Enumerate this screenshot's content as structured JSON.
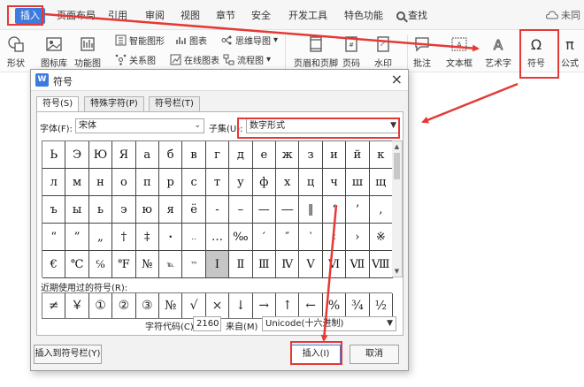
{
  "tabs": {
    "insert": "插入",
    "page_layout": "页面布局",
    "reference": "引用",
    "review": "审阅",
    "view": "视图",
    "chapter": "章节",
    "security": "安全",
    "dev_tools": "开发工具",
    "special": "特色功能",
    "search": "查找",
    "cloud": "未同"
  },
  "ribbon": {
    "shape": "形状",
    "gallery": "图标库",
    "func_chart": "功能图",
    "smart_art": "智能图形",
    "chart": "图表",
    "mind_map": "思维导图",
    "relation_map": "关系图",
    "online_chart": "在线图表",
    "flow_chart": "流程图",
    "header_footer": "页眉和页脚",
    "page_number": "页码",
    "watermark": "水印",
    "comment": "批注",
    "textbox": "文本框",
    "art_text": "艺术字",
    "symbol": "符号",
    "formula": "公式"
  },
  "dialog": {
    "title": "符号",
    "logo": "W",
    "close": "×",
    "tabs": [
      "符号(S)",
      "特殊字符(P)",
      "符号栏(T)"
    ],
    "font_label": "字体(F):",
    "font_value": "宋体",
    "subset_label": "子集(U):",
    "subset_value": "数字形式",
    "recent_label": "近期使用过的符号(R):",
    "code_label": "字符代码(C):",
    "code_value": "2160",
    "from_label": "来自(M)",
    "from_value": "Unicode(十六进制)",
    "insert_to_bar": "插入到符号栏(Y)",
    "insert": "插入(I)",
    "cancel": "取消"
  },
  "grid": {
    "rows": [
      [
        "Ь",
        "Э",
        "Ю",
        "Я",
        "а",
        "б",
        "в",
        "г",
        "д",
        "е",
        "ж",
        "з",
        "и",
        "й",
        "к"
      ],
      [
        "л",
        "м",
        "н",
        "о",
        "п",
        "р",
        "с",
        "т",
        "у",
        "ф",
        "х",
        "ц",
        "ч",
        "ш",
        "щ"
      ],
      [
        "ъ",
        "ы",
        "ь",
        "э",
        "ю",
        "я",
        "ё",
        "-",
        "–",
        "—",
        "―",
        "‖",
        "‘",
        "’",
        "‚"
      ],
      [
        "“",
        "”",
        "„",
        "†",
        "‡",
        "•",
        "‥",
        "…",
        "‰",
        "′",
        "″",
        "‵",
        "‹",
        "›",
        "※"
      ],
      [
        "€",
        "℃",
        "℅",
        "℉",
        "№",
        "℡",
        "™",
        "Ⅰ",
        "Ⅱ",
        "Ⅲ",
        "Ⅳ",
        "Ⅴ",
        "Ⅵ",
        "Ⅶ",
        "Ⅷ"
      ]
    ],
    "highlight": "Ⅰ"
  },
  "recent": [
    "≠",
    "￥",
    "①",
    "②",
    "③",
    "№",
    "√",
    "×",
    "↓",
    "→",
    "↑",
    "←",
    "%",
    "¾",
    "½"
  ],
  "colors": {
    "accent": "#3c7be0",
    "annotation": "#e53935"
  }
}
